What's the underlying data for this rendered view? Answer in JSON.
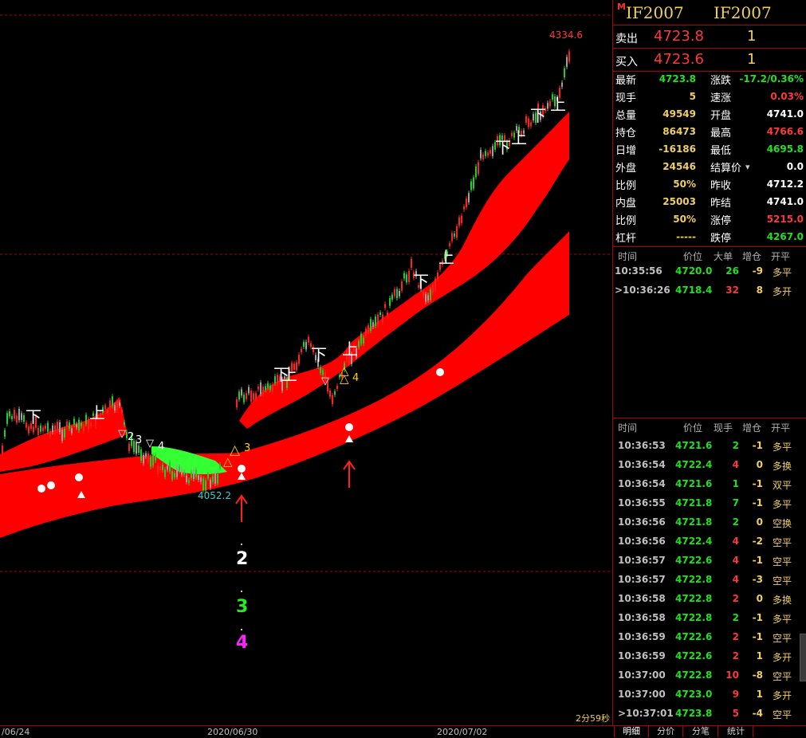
{
  "chart": {
    "price_high_label": "4334.6",
    "price_low_label": "4052.2",
    "dates": [
      "/06/24",
      "2020/06/30",
      "2020/07/02"
    ],
    "timer": "2分59秒",
    "annotations": {
      "down": "下",
      "up": "上",
      "num2": "2",
      "num3": "3",
      "num4": "4"
    },
    "colors": {
      "band": "#ff0000",
      "up_candle": "#ff2020",
      "down_candle": "#20d020",
      "neutral_candle": "#a0a0a0",
      "green_zone": "#33ff33",
      "marker_yellow": "#ffd000",
      "marker_white": "#ffffff",
      "num2": "#ffffff",
      "num3": "#22ee22",
      "num4": "#ff22ff"
    }
  },
  "panel": {
    "marker": "M",
    "code_left": "IF2007",
    "code_right": "IF2007",
    "sell": {
      "label": "卖出",
      "price": "4723.8",
      "volume": "1"
    },
    "buy": {
      "label": "买入",
      "price": "4723.6",
      "volume": "1"
    },
    "stats_left": [
      {
        "label": "最新",
        "value": "4723.8",
        "color": "#20e020"
      },
      {
        "label": "现手",
        "value": "5",
        "color": "#f0d060"
      },
      {
        "label": "总量",
        "value": "49549",
        "color": "#f0d060"
      },
      {
        "label": "持仓",
        "value": "86473",
        "color": "#f0d060"
      },
      {
        "label": "日增",
        "value": "-16186",
        "color": "#f0d060"
      },
      {
        "label": "外盘",
        "value": "24546",
        "color": "#f0d060"
      },
      {
        "label": "比例",
        "value": "50%",
        "color": "#f0d060"
      },
      {
        "label": "内盘",
        "value": "25003",
        "color": "#f0d060"
      },
      {
        "label": "比例",
        "value": "50%",
        "color": "#f0d060"
      },
      {
        "label": "杠杆",
        "value": "-----",
        "color": "#f0d060"
      }
    ],
    "stats_right": [
      {
        "label": "涨跌",
        "value": "-17.2/0.36%",
        "color": "#20e020"
      },
      {
        "label": "速涨",
        "value": "0.03%",
        "color": "#ff3838"
      },
      {
        "label": "开盘",
        "value": "4741.0",
        "color": "#ffffff"
      },
      {
        "label": "最高",
        "value": "4766.6",
        "color": "#ff3838"
      },
      {
        "label": "最低",
        "value": "4695.8",
        "color": "#20e020"
      },
      {
        "label": "结算价",
        "value": "0.0",
        "color": "#ffffff"
      },
      {
        "label": "昨收",
        "value": "4712.2",
        "color": "#ffffff"
      },
      {
        "label": "昨结",
        "value": "4741.0",
        "color": "#ffffff"
      },
      {
        "label": "涨停",
        "value": "5215.0",
        "color": "#ff3838"
      },
      {
        "label": "跌停",
        "value": "4267.0",
        "color": "#20e020"
      }
    ],
    "big_orders": {
      "headers": [
        "时间",
        "价位",
        "大单",
        "增仓",
        "开平"
      ],
      "rows": [
        {
          "time": "10:35:56",
          "price": "4720.0",
          "qty": "26",
          "oi": "-9",
          "type": "多平",
          "price_color": "#20e020",
          "qty_color": "#20e020",
          "type_color": "#f0d060",
          "selected": false
        },
        {
          "time": ">10:36:26",
          "price": "4718.4",
          "qty": "32",
          "oi": "8",
          "type": "多开",
          "price_color": "#20e020",
          "qty_color": "#ff3838",
          "type_color": "#f0d060",
          "selected": true
        }
      ]
    },
    "ticks": {
      "headers": [
        "时间",
        "价位",
        "现手",
        "增仓",
        "开平"
      ],
      "rows": [
        {
          "time": "10:36:53",
          "price": "4721.6",
          "qty": "2",
          "oi": "-1",
          "type": "多平",
          "qc": "#20e020"
        },
        {
          "time": "10:36:54",
          "price": "4722.4",
          "qty": "4",
          "oi": "0",
          "type": "多换",
          "qc": "#ff3838"
        },
        {
          "time": "10:36:54",
          "price": "4721.6",
          "qty": "1",
          "oi": "-1",
          "type": "双平",
          "qc": "#20e020"
        },
        {
          "time": "10:36:55",
          "price": "4721.8",
          "qty": "7",
          "oi": "-1",
          "type": "多平",
          "qc": "#20e020"
        },
        {
          "time": "10:36:56",
          "price": "4721.8",
          "qty": "2",
          "oi": "0",
          "type": "空换",
          "qc": "#20e020"
        },
        {
          "time": "10:36:56",
          "price": "4722.4",
          "qty": "4",
          "oi": "-2",
          "type": "空平",
          "qc": "#ff3838"
        },
        {
          "time": "10:36:57",
          "price": "4722.6",
          "qty": "4",
          "oi": "-1",
          "type": "空平",
          "qc": "#ff3838"
        },
        {
          "time": "10:36:57",
          "price": "4722.8",
          "qty": "4",
          "oi": "-3",
          "type": "空平",
          "qc": "#ff3838"
        },
        {
          "time": "10:36:58",
          "price": "4722.8",
          "qty": "2",
          "oi": "0",
          "type": "多换",
          "qc": "#ff3838"
        },
        {
          "time": "10:36:58",
          "price": "4722.8",
          "qty": "2",
          "oi": "-1",
          "type": "多平",
          "qc": "#20e020"
        },
        {
          "time": "10:36:59",
          "price": "4722.6",
          "qty": "2",
          "oi": "-1",
          "type": "空平",
          "qc": "#ff3838"
        },
        {
          "time": "10:36:59",
          "price": "4722.6",
          "qty": "2",
          "oi": "1",
          "type": "多开",
          "qc": "#ff3838"
        },
        {
          "time": "10:37:00",
          "price": "4722.8",
          "qty": "10",
          "oi": "-8",
          "type": "空平",
          "qc": "#ff3838"
        },
        {
          "time": "10:37:00",
          "price": "4723.0",
          "qty": "9",
          "oi": "1",
          "type": "多开",
          "qc": "#ff3838"
        },
        {
          "time": ">10:37:01",
          "price": "4723.8",
          "qty": "5",
          "oi": "-4",
          "type": "空平",
          "qc": "#ff3838"
        }
      ]
    },
    "tabs": [
      "明细",
      "分价",
      "分笔",
      "统计"
    ]
  }
}
